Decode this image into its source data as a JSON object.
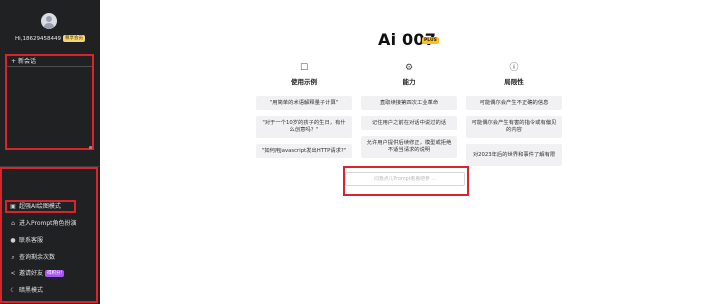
{
  "sidebar": {
    "username": "Hi,18629458449",
    "vip_badge": "尊享会员",
    "new_chat_label": "新会话",
    "menu": [
      {
        "icon": "image-icon",
        "glyph": "▣",
        "label": "超强AI绘图模式"
      },
      {
        "icon": "shop-icon",
        "glyph": "⌂",
        "label": "进入Prompt角色扮演"
      },
      {
        "icon": "chat-icon",
        "glyph": "●",
        "label": "联系客服"
      },
      {
        "icon": "search-icon",
        "glyph": "⌕",
        "label": "查询剩余次数"
      },
      {
        "icon": "share-icon",
        "glyph": "<",
        "label": "邀请好友",
        "badge": "得积分!"
      },
      {
        "icon": "moon-icon",
        "glyph": "☾",
        "label": "暗黑模式"
      }
    ]
  },
  "main": {
    "title": "Ai 007",
    "plus_badge": "PLUS",
    "columns": [
      {
        "icon": "message-square-icon",
        "glyph": "☐",
        "heading": "使用示例",
        "cards": [
          "\"用简单的术语解释量子计算\"",
          "\"对于一个10岁的孩子的生日，有什么创意吗？\"",
          "\"如何用Javascript发出HTTP请求?\""
        ]
      },
      {
        "icon": "zap-icon",
        "glyph": "⚙",
        "heading": "能力",
        "cards": [
          "直取续接第四次工业革命",
          "记住用户之前在对话中说过的话",
          "允许用户提供后续修正，模型或拒绝不适当请求的说明"
        ]
      },
      {
        "icon": "alert-circle-icon",
        "glyph": "ⓘ",
        "heading": "局限性",
        "cards": [
          "可能偶尔会产生不正确的信息",
          "可能偶尔会产生有害的指令或有偏见的内容",
          "对2023年后的世界和事件了解有限"
        ]
      }
    ],
    "input_placeholder": "问我点儿Prompt看看吧参 ..."
  }
}
